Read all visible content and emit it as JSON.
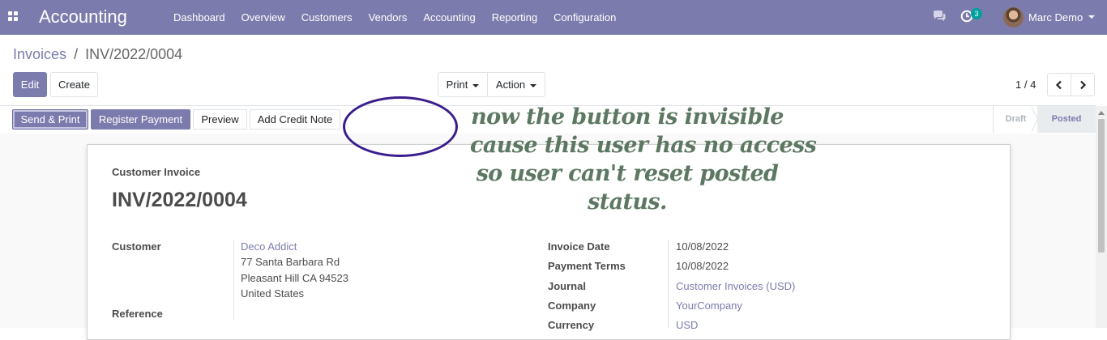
{
  "navbar": {
    "app_name": "Accounting",
    "menu": [
      "Dashboard",
      "Overview",
      "Customers",
      "Vendors",
      "Accounting",
      "Reporting",
      "Configuration"
    ],
    "activity_count": "3",
    "user_name": "Marc Demo",
    "bg_color": "#7c7bad"
  },
  "breadcrumb": {
    "parent": "Invoices",
    "separator": "/",
    "current": "INV/2022/0004"
  },
  "control": {
    "edit_label": "Edit",
    "create_label": "Create",
    "print_label": "Print",
    "action_label": "Action",
    "pager": "1 / 4"
  },
  "statusbar": {
    "buttons": [
      "Send & Print",
      "Register Payment",
      "Preview",
      "Add Credit Note"
    ],
    "stages": [
      "Draft",
      "Posted"
    ],
    "current_stage": "Posted"
  },
  "invoice": {
    "doc_type": "Customer Invoice",
    "number": "INV/2022/0004",
    "customer_label": "Customer",
    "customer_name": "Deco Addict",
    "address": [
      "77 Santa Barbara Rd",
      "Pleasant Hill CA 94523",
      "United States"
    ],
    "reference_label": "Reference",
    "fields": [
      {
        "label": "Invoice Date",
        "value": "10/08/2022"
      },
      {
        "label": "Payment Terms",
        "value": "10/08/2022"
      },
      {
        "label": "Journal",
        "value": "Customer Invoices (USD)"
      },
      {
        "label": "Company",
        "value": "YourCompany"
      },
      {
        "label": "Currency",
        "value": "USD"
      }
    ]
  },
  "annotation": {
    "lines": [
      "now the button is invisible",
      "cause this user has no access",
      "so user can't reset posted",
      "status."
    ],
    "color": "#5d7862",
    "oval_color": "#3a1d8c"
  }
}
